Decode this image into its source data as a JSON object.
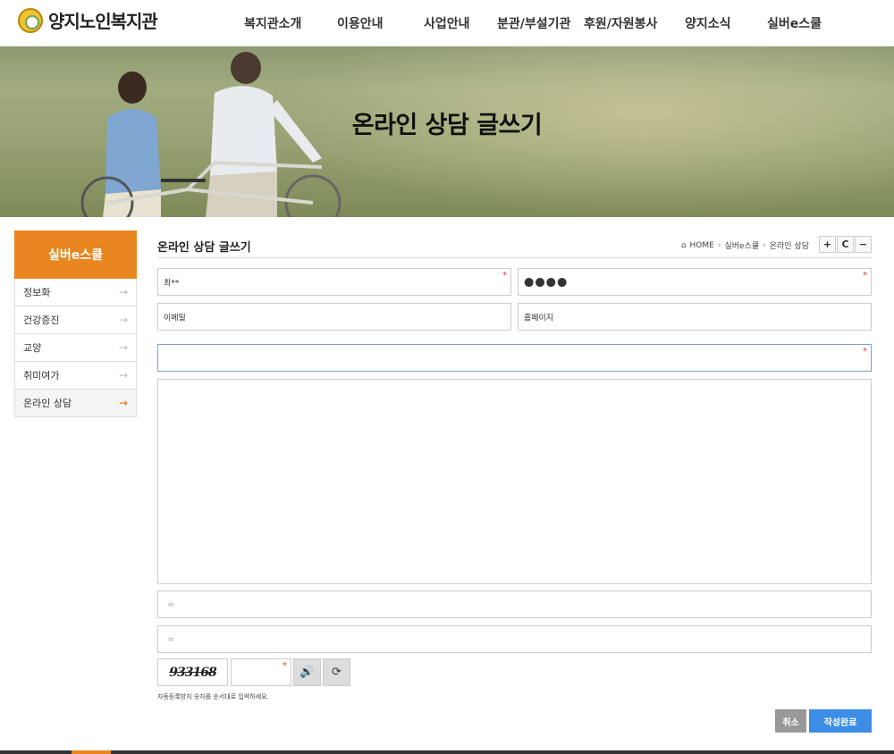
{
  "header": {
    "logo_text": "양지노인복지관",
    "menu": [
      "복지관소개",
      "이용안내",
      "사업안내",
      "분관/부설기관",
      "후원/자원봉사",
      "양지소식",
      "실버e스쿨"
    ]
  },
  "banner": {
    "title": "온라인 상담 글쓰기"
  },
  "sidebar": {
    "title": "실버e스쿨",
    "items": [
      {
        "label": "정보화"
      },
      {
        "label": "건강증진"
      },
      {
        "label": "교양"
      },
      {
        "label": "취미여가"
      },
      {
        "label": "온라인 상담"
      }
    ]
  },
  "content": {
    "title": "온라인 상담 글쓰기",
    "breadcrumb": [
      "HOME",
      "실버e스쿨",
      "온라인 상담"
    ],
    "tools": [
      "+",
      "C",
      "−"
    ]
  },
  "form": {
    "name_value": "최**",
    "password_value": "●●●●",
    "email_placeholder": "이메일",
    "homepage_placeholder": "홈페이지",
    "subject_value": "",
    "captcha_text": "933168",
    "captcha_help": "자동등록방지 숫자를 순서대로 입력하세요.",
    "cancel_label": "취소",
    "submit_label": "작성완료"
  },
  "colors": {
    "accent": "#e8861f",
    "submit": "#3b8de6",
    "required": "#e53935"
  }
}
